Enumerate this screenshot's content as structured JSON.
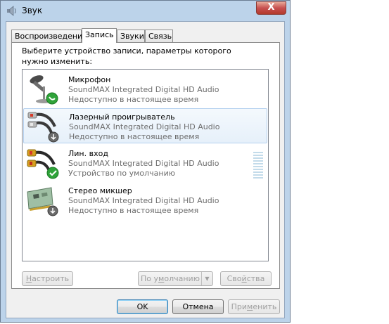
{
  "window": {
    "title": "Звук",
    "close_label": "X"
  },
  "tabs": [
    {
      "label": "Воспроизведение"
    },
    {
      "label": "Запись"
    },
    {
      "label": "Звуки"
    },
    {
      "label": "Связь"
    }
  ],
  "instruction": "Выберите устройство записи, параметры которого нужно изменить:",
  "devices": [
    {
      "name": "Микрофон",
      "driver": "SoundMAX Integrated Digital HD Audio",
      "status": "Недоступно в настоящее время",
      "icon": "microphone-icon",
      "badge": "phone-badge"
    },
    {
      "name": "Лазерный проигрыватель",
      "driver": "SoundMAX Integrated Digital HD Audio",
      "status": "Недоступно в настоящее время",
      "icon": "rca-cable-icon",
      "badge": "down-arrow-badge"
    },
    {
      "name": "Лин. вход",
      "driver": "SoundMAX Integrated Digital HD Audio",
      "status": "Устройство по умолчанию",
      "icon": "line-in-cable-icon",
      "badge": "check-badge"
    },
    {
      "name": "Стерео микшер",
      "driver": "SoundMAX Integrated Digital HD Audio",
      "status": "Недоступно в настоящее время",
      "icon": "sound-card-icon",
      "badge": "down-arrow-badge"
    }
  ],
  "buttons": {
    "configure": {
      "pre": "",
      "u": "Н",
      "post": "астроить"
    },
    "default": {
      "pre": "По у",
      "u": "м",
      "post": "олчанию"
    },
    "properties": {
      "pre": "Сво",
      "u": "й",
      "post": "ства"
    },
    "ok": "OK",
    "cancel": "Отмена",
    "apply": {
      "pre": "При",
      "u": "м",
      "post": "енить"
    }
  },
  "colors": {
    "selection": "#e6f0fa",
    "badge_green": "#2fa33a",
    "window_frame": "#bcd3ea"
  }
}
